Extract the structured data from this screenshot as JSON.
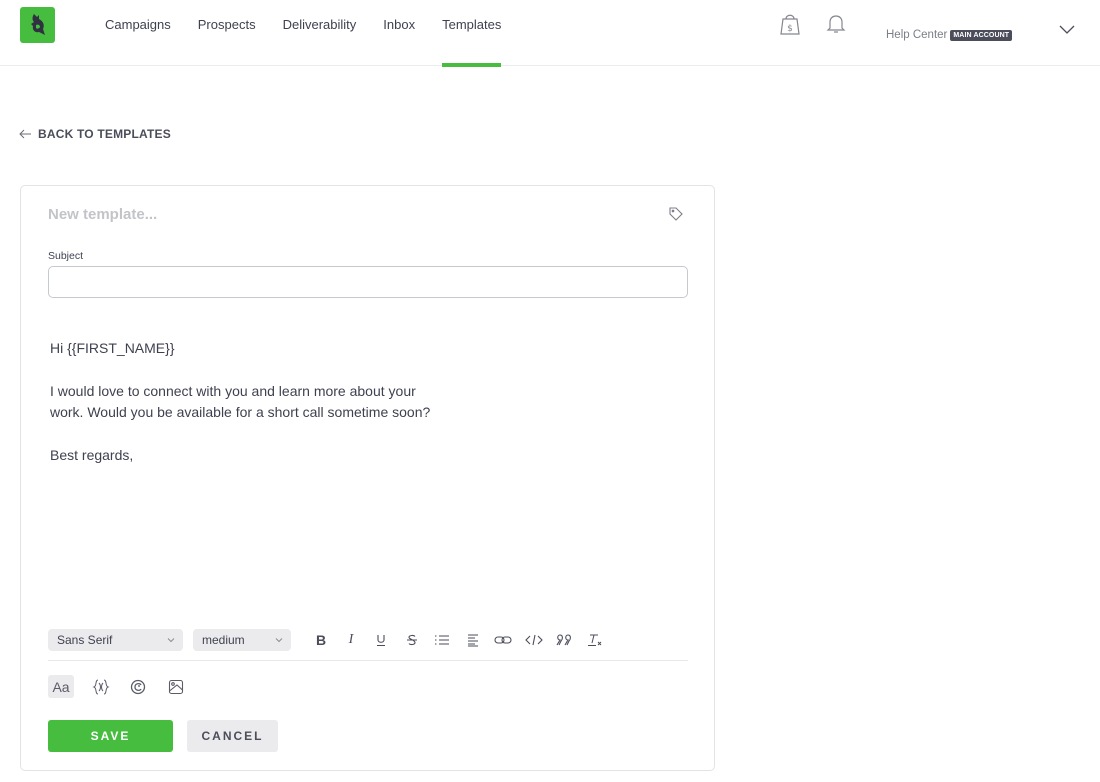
{
  "brand": {
    "accent": "#47bd3f",
    "logo": "wolf-logo"
  },
  "nav": {
    "items": [
      {
        "label": "Campaigns",
        "active": false
      },
      {
        "label": "Prospects",
        "active": false
      },
      {
        "label": "Deliverability",
        "active": false
      },
      {
        "label": "Inbox",
        "active": false
      },
      {
        "label": "Templates",
        "active": true
      }
    ],
    "icons": [
      "shopping-bag-dollar-icon",
      "bell-icon"
    ],
    "help_center": "Help Center",
    "account_badge": "MAIN ACCOUNT",
    "account_menu_icon": "chevron-down-icon"
  },
  "back_link": {
    "label": "BACK TO TEMPLATES",
    "icon": "arrow-left-icon"
  },
  "editor": {
    "name_placeholder": "New template...",
    "name_value": "",
    "tag_icon": "tag-icon",
    "subject_label": "Subject",
    "subject_value": "",
    "body_lines": [
      "Hi {{FIRST_NAME}}",
      "",
      "I would love to connect with you and learn more about your",
      "work. Would you be available for a short call sometime soon?",
      "",
      "Best regards,"
    ],
    "toolbar": {
      "font_family": "Sans Serif",
      "font_size": "medium",
      "buttons": [
        "bold",
        "italic",
        "underline",
        "strikethrough",
        "bullet-list",
        "align",
        "link",
        "code",
        "blockquote",
        "clear-format"
      ],
      "bold_glyph": "B",
      "italic_glyph": "I",
      "secondary": [
        "text-format",
        "variables",
        "copyright",
        "image"
      ],
      "text_format_label": "Aa"
    },
    "save_label": "SAVE",
    "cancel_label": "CANCEL"
  }
}
